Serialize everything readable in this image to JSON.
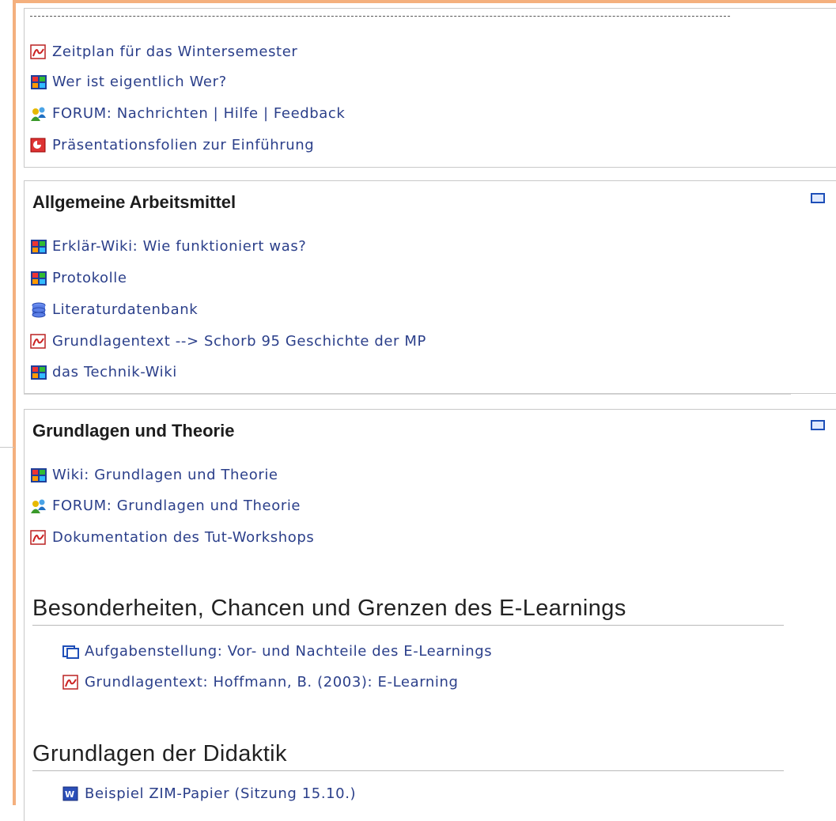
{
  "top_section": {
    "items": [
      {
        "label": "Zeitplan für das Wintersemester",
        "icon": "pdf-icon"
      },
      {
        "label": "Wer ist eigentlich Wer?",
        "icon": "wiki-icon"
      },
      {
        "label": "FORUM: Nachrichten | Hilfe | Feedback",
        "icon": "forum-icon"
      },
      {
        "label": "Präsentationsfolien zur Einführung",
        "icon": "presentation-icon"
      }
    ]
  },
  "section_arbeitsmittel": {
    "title": "Allgemeine Arbeitsmittel",
    "items": [
      {
        "label": "Erklär-Wiki: Wie funktioniert was?",
        "icon": "wiki-icon"
      },
      {
        "label": "Protokolle",
        "icon": "wiki-icon"
      },
      {
        "label": "Literaturdatenbank",
        "icon": "database-icon"
      },
      {
        "label": "Grundlagentext --> Schorb 95 Geschichte der MP",
        "icon": "pdf-icon"
      },
      {
        "label": "das Technik-Wiki",
        "icon": "wiki-icon"
      }
    ]
  },
  "section_grundlagen": {
    "title": "Grundlagen und Theorie",
    "items": [
      {
        "label": "Wiki: Grundlagen und Theorie",
        "icon": "wiki-icon"
      },
      {
        "label": "FORUM: Grundlagen und Theorie",
        "icon": "forum-icon"
      },
      {
        "label": "Dokumentation des Tut-Workshops",
        "icon": "pdf-icon"
      }
    ],
    "subsections": [
      {
        "title": "Besonderheiten, Chancen und Grenzen des E-Learnings",
        "items": [
          {
            "label": "Aufgabenstellung: Vor- und Nachteile des E-Learnings",
            "icon": "assignment-icon"
          },
          {
            "label": "Grundlagentext: Hoffmann, B. (2003): E-Learning",
            "icon": "pdf-icon"
          }
        ]
      },
      {
        "title": "Grundlagen der Didaktik",
        "items": [
          {
            "label": "Beispiel ZIM-Papier (Sitzung 15.10.)",
            "icon": "word-icon"
          }
        ]
      }
    ]
  },
  "colors": {
    "link": "#2b3f8a",
    "accent_border": "#f4b07e",
    "collapse_icon": "#1e4fb8"
  }
}
